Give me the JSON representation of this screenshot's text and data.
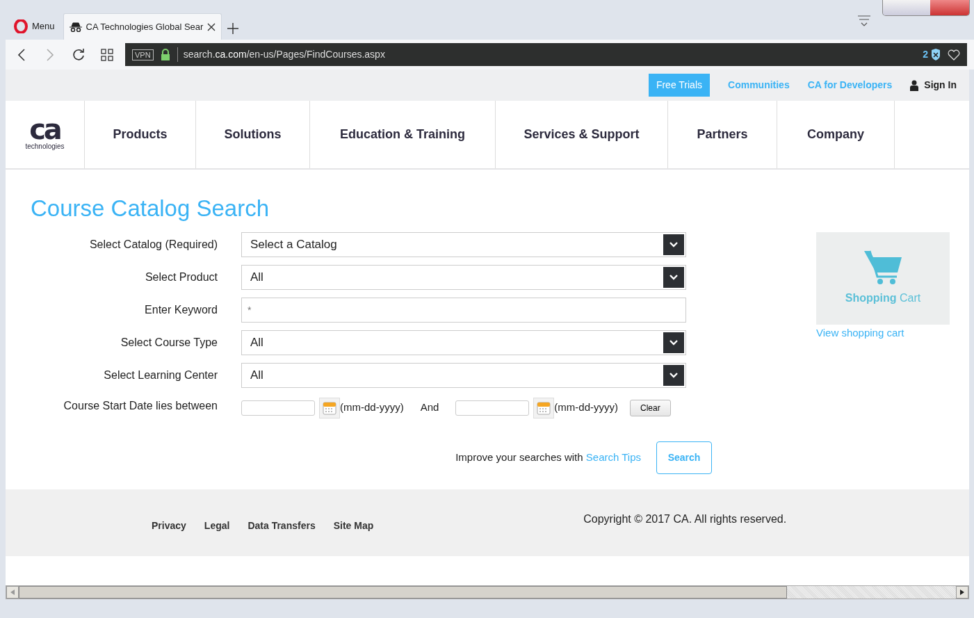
{
  "browser": {
    "menu_label": "Menu",
    "tab": {
      "title": "CA Technologies Global Sear",
      "selected": true
    },
    "vpn_label": "VPN",
    "url": "search.**ca.com**/en-us/Pages/FindCourses.aspx",
    "blocked_count": "2"
  },
  "utility_links": [
    {
      "label": "Free Trials",
      "kind": "primary"
    },
    {
      "label": "Communities",
      "kind": "link"
    },
    {
      "label": "CA for Developers",
      "kind": "link"
    },
    {
      "label": "Sign In",
      "kind": "user"
    }
  ],
  "logo": {
    "mark": "ca",
    "subtitle": "technologies"
  },
  "nav": [
    "Products",
    "Solutions",
    "Education & Training",
    "Services & Support",
    "Partners",
    "Company"
  ],
  "page_title": "Course Catalog Search",
  "form": {
    "fields": [
      {
        "label": "Select Catalog (Required)",
        "kind": "select",
        "value": "Select a Catalog"
      },
      {
        "label": "Select Product",
        "kind": "select",
        "value": "All"
      },
      {
        "label": "Enter Keyword",
        "kind": "text",
        "placeholder": "*"
      },
      {
        "label": "Select Course Type",
        "kind": "select",
        "value": "All"
      },
      {
        "label": "Select Learning Center",
        "kind": "select",
        "value": "All"
      },
      {
        "label": "Course Start Date lies between",
        "kind": "daterange",
        "from_format": "(mm-dd-yyyy)",
        "joiner": "And",
        "to_format": "(mm-dd-yyyy)",
        "clear_label": "Clear"
      }
    ],
    "hint": "Improve your searches with",
    "hint_link": "Search Tips",
    "search_label": "Search"
  },
  "cart": {
    "caption": "**Shopping** Cart",
    "link": "View shopping cart"
  },
  "footer": {
    "links": [
      "Privacy",
      "Legal",
      "Data Transfers",
      "Site Map"
    ],
    "copyright": "Copyright © 2017 CA. All rights reserved."
  }
}
